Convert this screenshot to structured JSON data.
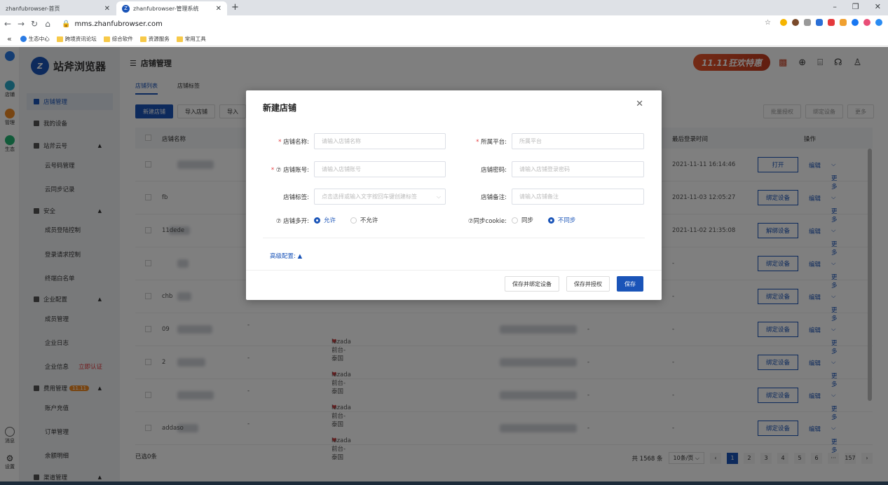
{
  "browser": {
    "tabs": [
      {
        "label": "zhanfubrowser-首页"
      },
      {
        "label": "zhanfubrowser-管理系统"
      }
    ],
    "url": "mms.zhanfubrowser.com",
    "bookmarks": [
      "生态中心",
      "跨境资讯论坛",
      "综合软件",
      "资源服务",
      "常用工具"
    ]
  },
  "rail": [
    {
      "label": "店铺"
    },
    {
      "label": "管理"
    },
    {
      "label": "生态"
    },
    {
      "label": "消息"
    },
    {
      "label": "设置"
    }
  ],
  "sidebar": {
    "logo_text": "站斧浏览器",
    "items": [
      {
        "label": "店铺管理"
      },
      {
        "label": "我的设备"
      },
      {
        "label": "站斧云号"
      },
      {
        "label": "云号码管理"
      },
      {
        "label": "云同步记录"
      },
      {
        "label": "安全"
      },
      {
        "label": "成员登陆控制"
      },
      {
        "label": "登录请求控制"
      },
      {
        "label": "终端白名单"
      },
      {
        "label": "企业配置"
      },
      {
        "label": "成员管理"
      },
      {
        "label": "企业日志"
      },
      {
        "label": "企业信息"
      },
      {
        "label": "费用管理"
      },
      {
        "label": "账户充值"
      },
      {
        "label": "订单管理"
      },
      {
        "label": "余额明细"
      },
      {
        "label": "渠道管理"
      }
    ],
    "verify_label": "立即认证",
    "fee_badge": "11.11"
  },
  "header": {
    "title": "店铺管理",
    "promo": "11.11狂欢特惠"
  },
  "subtabs": [
    "店铺列表",
    "店铺标签"
  ],
  "toolbar": {
    "new_shop": "新建店铺",
    "import_shop": "导入店铺",
    "import2": "导入",
    "batch_auth": "批量授权",
    "bind_device": "绑定设备",
    "more": "更多"
  },
  "table": {
    "headers": {
      "name": "店铺名称",
      "last_login": "最后登录时间",
      "ops": "操作"
    },
    "rows": [
      {
        "name": "",
        "platform": "",
        "last_login": "2021-11-11 16:14:46",
        "action": "打开"
      },
      {
        "name": "fb",
        "platform": "",
        "last_login": "2021-11-03 12:05:27",
        "action": "绑定设备"
      },
      {
        "name": "11dede",
        "platform": "",
        "last_login": "2021-11-02 21:35:08",
        "action": "解绑设备"
      },
      {
        "name": "",
        "platform": "",
        "last_login": "-",
        "action": "绑定设备"
      },
      {
        "name": "chb",
        "platform": "",
        "last_login": "-",
        "action": "绑定设备"
      },
      {
        "name": "09",
        "platform": "lazada前台-泰国",
        "last_login": "-",
        "action": "绑定设备"
      },
      {
        "name": "2",
        "platform": "lazada前台-泰国",
        "last_login": "-",
        "action": "绑定设备"
      },
      {
        "name": "",
        "platform": "lazada前台-泰国",
        "last_login": "-",
        "action": "绑定设备"
      },
      {
        "name": "addaso",
        "platform": "lazada前台-泰国",
        "last_login": "-",
        "action": "绑定设备"
      }
    ],
    "edit_label": "编辑",
    "more_label": "更多",
    "dash": "-"
  },
  "footer": {
    "selected": "已选0条",
    "total": "共 1568 条",
    "page_size": "10条/页",
    "pages": [
      "1",
      "2",
      "3",
      "4",
      "5",
      "6",
      "···",
      "157"
    ]
  },
  "dialog": {
    "title": "新建店铺",
    "fields": {
      "shop_name_label": "店铺名称:",
      "shop_name_placeholder": "请输入店铺名称",
      "platform_label": "所属平台:",
      "platform_placeholder": "所属平台",
      "account_label": "店铺账号:",
      "account_placeholder": "请输入店铺账号",
      "password_label": "店铺密码:",
      "password_placeholder": "请输入店铺登录密码",
      "tag_label": "店铺标签:",
      "tag_placeholder": "点击选择或输入文字按回车键创建标签",
      "note_label": "店铺备注:",
      "note_placeholder": "请输入店铺备注",
      "multi_label": "店铺多开:",
      "multi_allow": "允许",
      "multi_deny": "不允许",
      "cookie_label": "同步cookie:",
      "cookie_sync": "同步",
      "cookie_nosync": "不同步"
    },
    "advanced": "高级配置:",
    "buttons": {
      "save_bind": "保存并绑定设备",
      "save_auth": "保存并授权",
      "save": "保存"
    }
  }
}
